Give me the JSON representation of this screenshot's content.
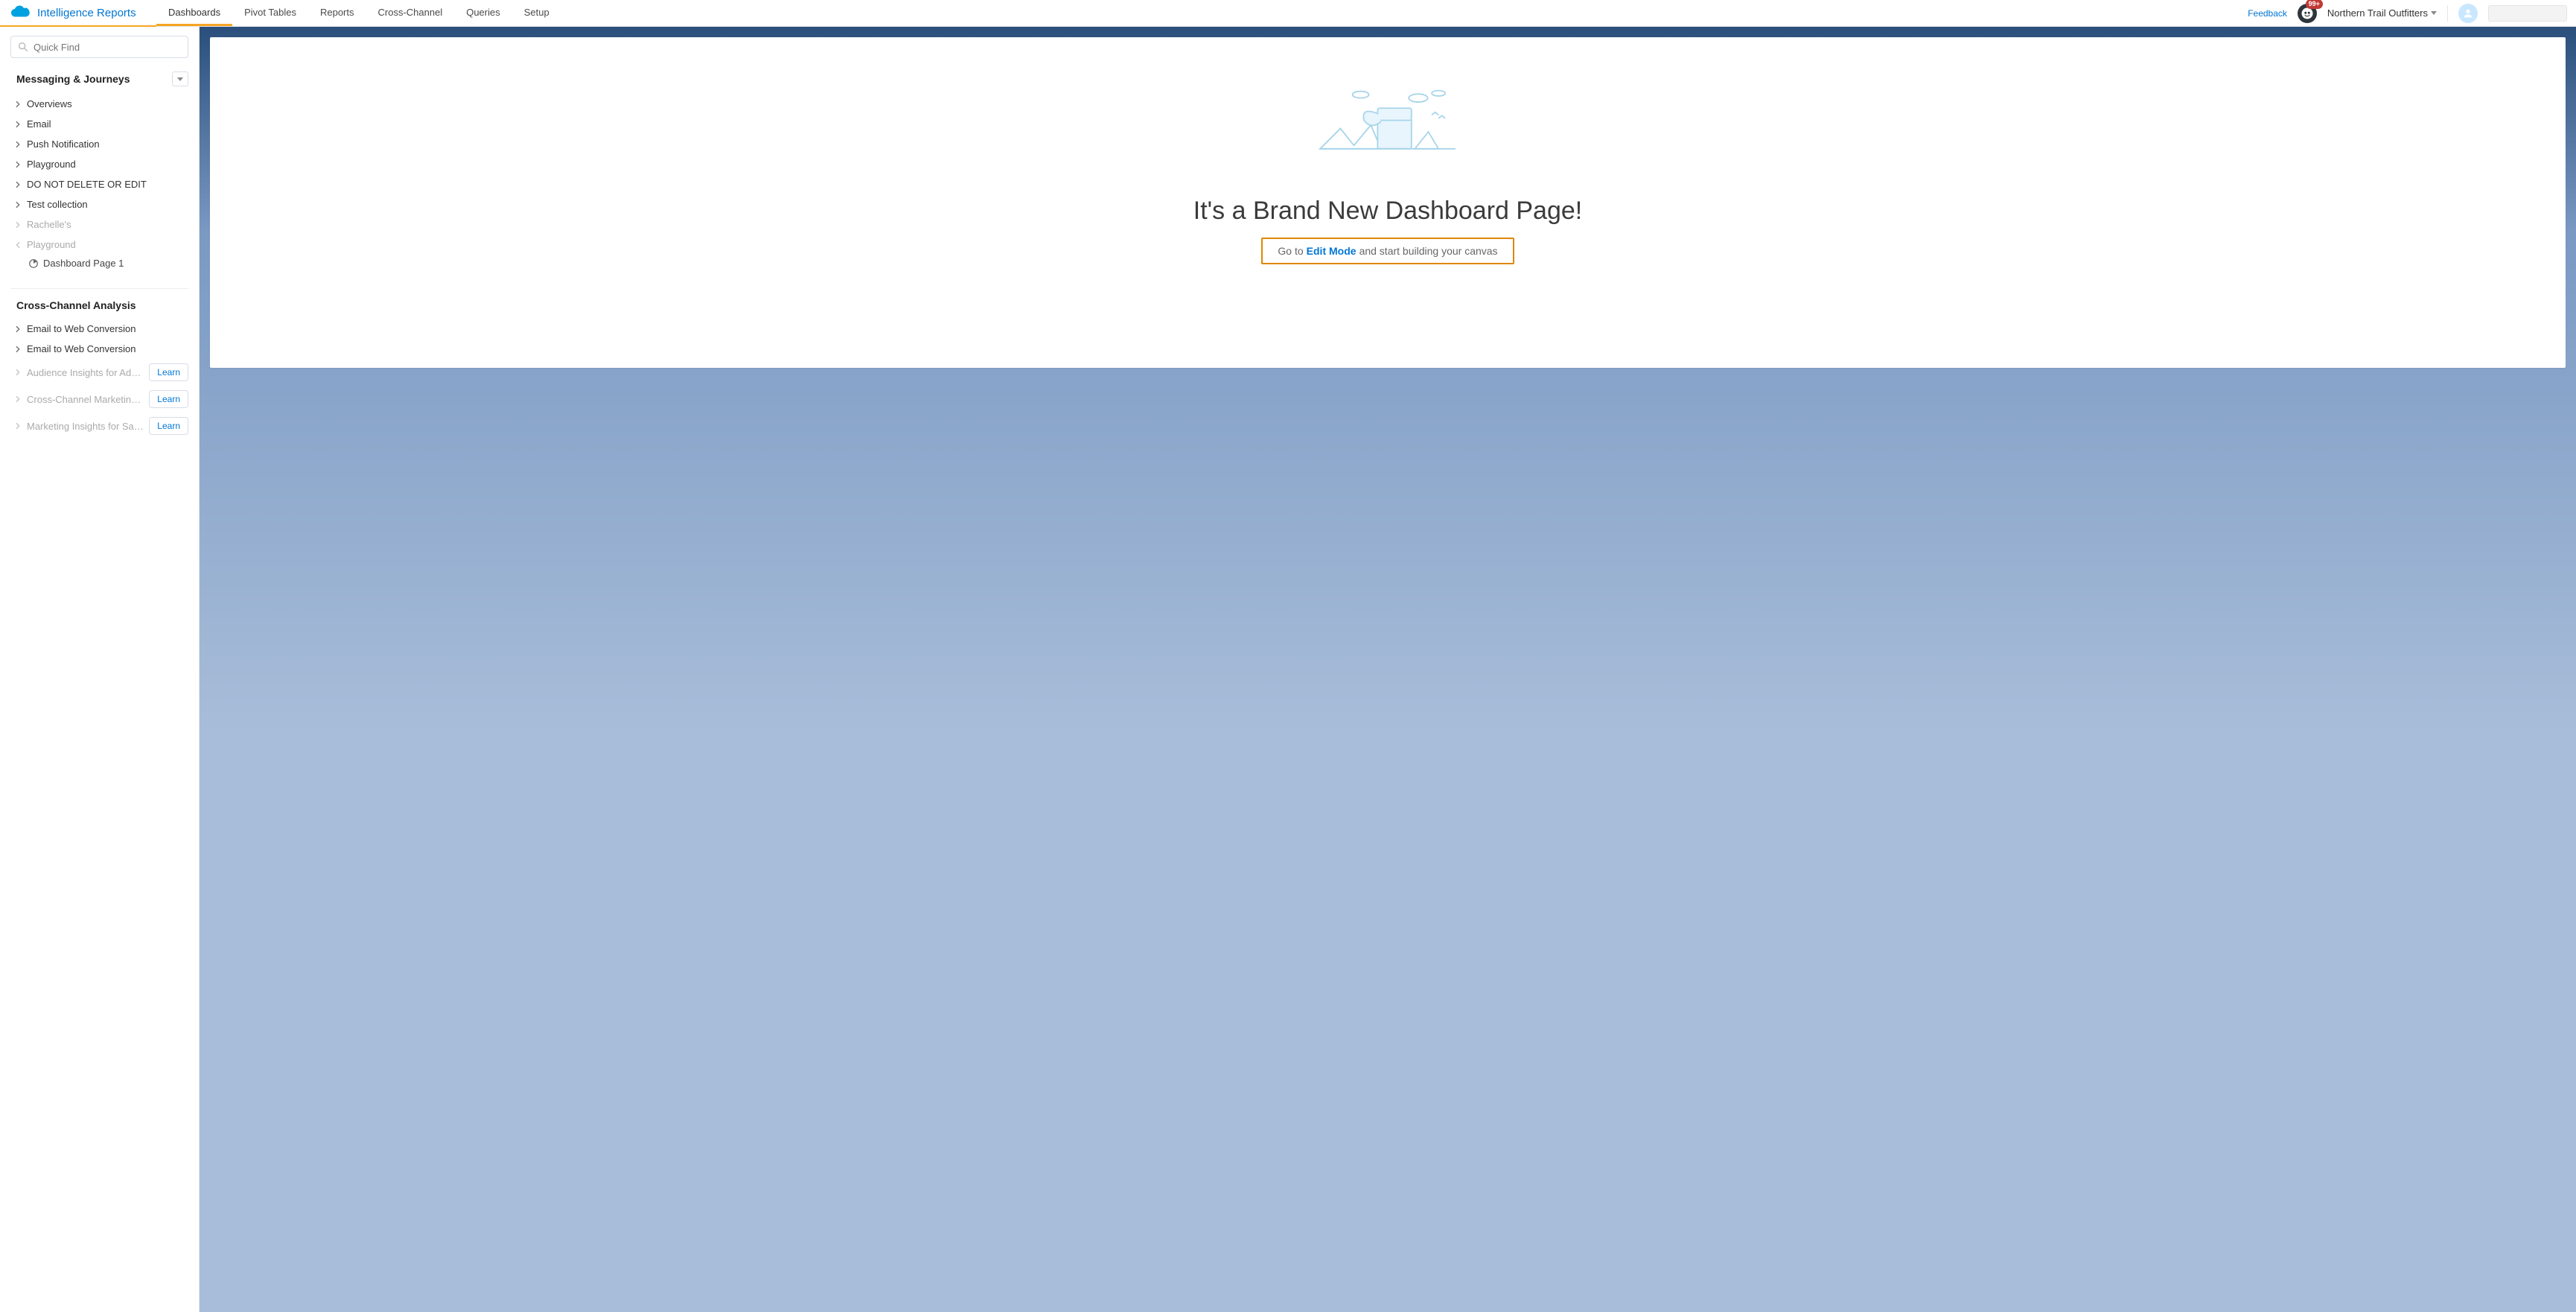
{
  "header": {
    "app_title": "Intelligence Reports",
    "tabs": [
      "Dashboards",
      "Pivot Tables",
      "Reports",
      "Cross-Channel",
      "Queries",
      "Setup"
    ],
    "active_tab_index": 0,
    "feedback_label": "Feedback",
    "badge_text": "99+",
    "org_name": "Northern Trail Outfitters"
  },
  "sidebar": {
    "quick_find_placeholder": "Quick Find",
    "section1_title": "Messaging & Journeys",
    "section1_items": [
      {
        "label": "Overviews",
        "muted": false
      },
      {
        "label": "Email",
        "muted": false
      },
      {
        "label": "Push Notification",
        "muted": false
      },
      {
        "label": "Playground",
        "muted": false
      },
      {
        "label": "DO NOT DELETE OR EDIT",
        "muted": false
      },
      {
        "label": "Test collection",
        "muted": false
      },
      {
        "label": "Rachelle's",
        "muted": true
      },
      {
        "label": "Playground",
        "muted": true,
        "open": true,
        "child": "Dashboard Page 1"
      }
    ],
    "section2_title": "Cross-Channel Analysis",
    "section2_items": [
      {
        "label": "Email to Web Conversion",
        "muted": false,
        "learn": false
      },
      {
        "label": "Email to Web Conversion",
        "muted": false,
        "learn": false
      },
      {
        "label": "Audience Insights for Adv…",
        "muted": true,
        "learn": true
      },
      {
        "label": "Cross-Channel Marketing …",
        "muted": true,
        "learn": true
      },
      {
        "label": "Marketing Insights for Sal…",
        "muted": true,
        "learn": true
      }
    ],
    "learn_label": "Learn"
  },
  "main": {
    "empty_title": "It's a Brand New Dashboard Page!",
    "cta_pre": "Go to ",
    "cta_link": "Edit Mode",
    "cta_post": " and start building your canvas"
  }
}
